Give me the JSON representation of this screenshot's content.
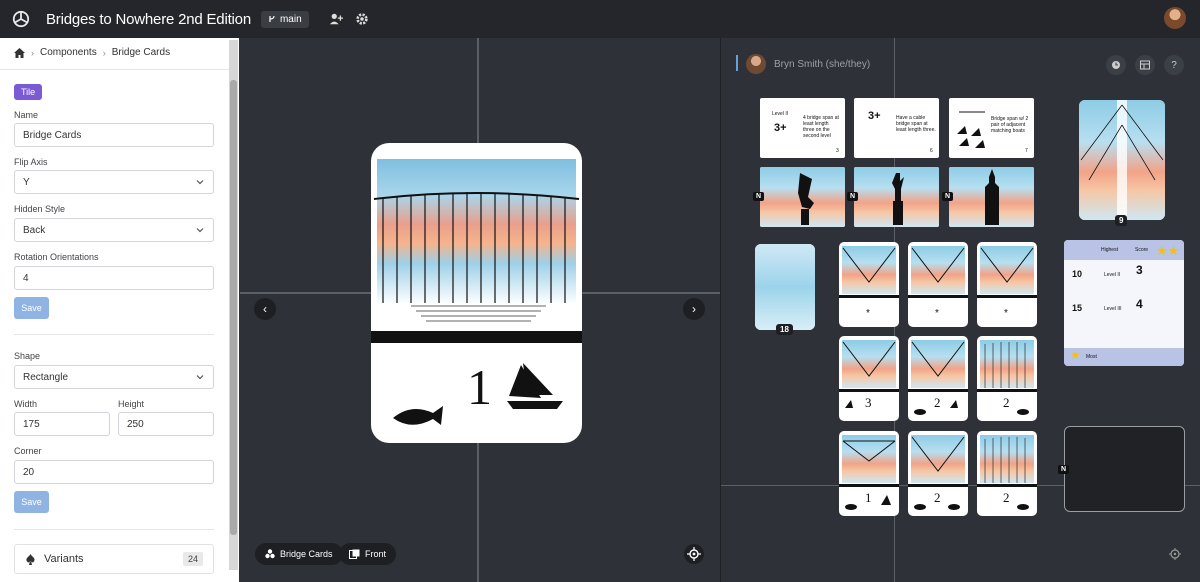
{
  "app": {
    "title": "Bridges to Nowhere 2nd Edition",
    "branch": "main"
  },
  "breadcrumb": {
    "items": [
      "Components",
      "Bridge Cards"
    ]
  },
  "sidebar": {
    "tag": "Tile",
    "name_label": "Name",
    "name_value": "Bridge Cards",
    "flip_label": "Flip Axis",
    "flip_value": "Y",
    "hidden_label": "Hidden Style",
    "hidden_value": "Back",
    "rot_label": "Rotation Orientations",
    "rot_value": "4",
    "save_label": "Save",
    "shape_label": "Shape",
    "shape_value": "Rectangle",
    "width_label": "Width",
    "width_value": "175",
    "height_label": "Height",
    "height_value": "250",
    "corner_label": "Corner",
    "corner_value": "20",
    "save2_label": "Save",
    "variants_label": "Variants",
    "variants_count": "24"
  },
  "canvas": {
    "chip_component": "Bridge Cards",
    "chip_side": "Front",
    "card_number": "1"
  },
  "right": {
    "user_name": "Bryn Smith (she/they)",
    "deck_count": "18",
    "stack_count": "9",
    "text_cards": [
      {
        "level": "Level II",
        "big": "3+",
        "text": "4 bridge span at least length three on the second level",
        "num": "3"
      },
      {
        "level": "",
        "big": "3+",
        "text": "Have a cable bridge span at least length three.",
        "num": "6"
      },
      {
        "level": "",
        "big": "",
        "text": "Bridge span w/ 2 pair of adjacent matching boats",
        "num": "7"
      }
    ],
    "tile_badges": [
      "N",
      "N",
      "N"
    ],
    "score_card": {
      "header_left": "Highest",
      "header_right": "Score",
      "row1_points": "10",
      "row1_level": "Level II",
      "row1_value": "3",
      "row2_points": "15",
      "row2_level": "Level III",
      "row2_value": "4",
      "footer": "Most"
    },
    "grid_numbers": [
      "3",
      "2",
      "2",
      "1",
      "2",
      "2"
    ],
    "slot_badge": "N"
  },
  "colors": {
    "accent": "#7b5ad6",
    "save": "#8fb4e3",
    "dark": "#24262b",
    "canvas": "#2e3138"
  }
}
